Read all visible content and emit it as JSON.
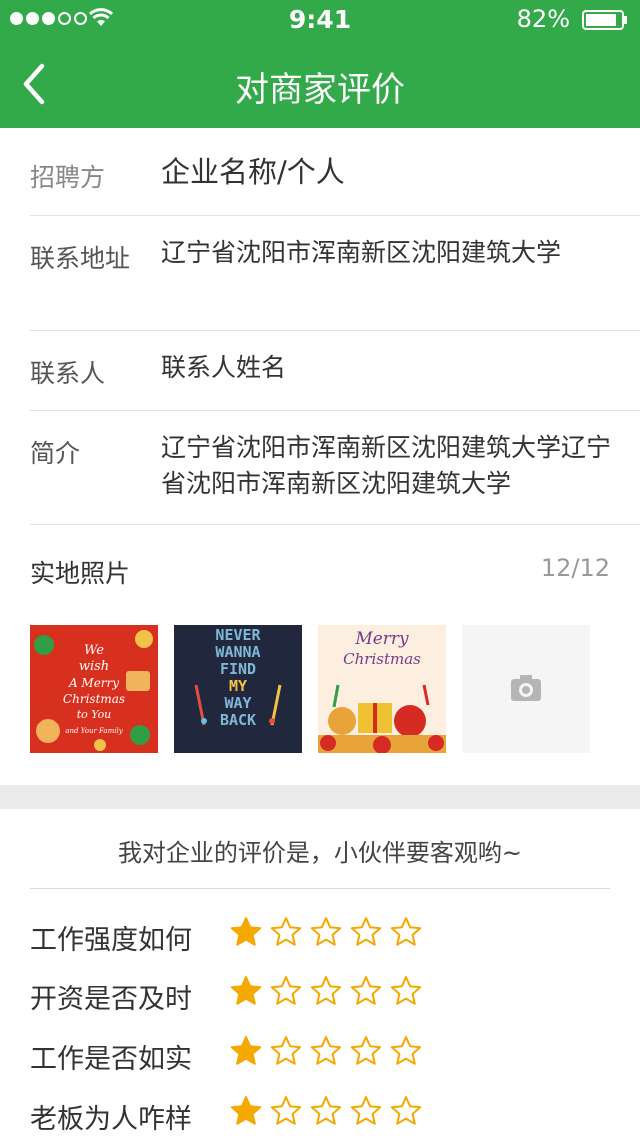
{
  "status": {
    "time": "9:41",
    "battery": "82%"
  },
  "nav": {
    "title": "对商家评价"
  },
  "info": {
    "employer_label": "招聘方",
    "employer_value": "企业名称/个人",
    "address_label": "联系地址",
    "address_value": "辽宁省沈阳市浑南新区沈阳建筑大学",
    "contact_label": "联系人",
    "contact_value": "联系人姓名",
    "intro_label": "简介",
    "intro_value": "辽宁省沈阳市浑南新区沈阳建筑大学辽宁省沈阳市浑南新区沈阳建筑大学"
  },
  "photos": {
    "title": "实地照片",
    "count": "12/12",
    "thumb1": {
      "lines": [
        "We",
        "wish",
        "A Merry",
        "Christmas",
        "to You",
        "and Your Family"
      ]
    },
    "thumb2": {
      "lines": [
        "NEVER",
        "WANNA",
        "FIND",
        "MY",
        "WAY",
        "BACK"
      ]
    },
    "thumb3": {
      "lines": [
        "Merry",
        "Christmas"
      ]
    }
  },
  "rating": {
    "heading": "我对企业的评价是，小伙伴要客观哟~",
    "items": [
      {
        "label": "工作强度如何",
        "stars": 1,
        "max": 5
      },
      {
        "label": "开资是否及时",
        "stars": 1,
        "max": 5
      },
      {
        "label": "工作是否如实",
        "stars": 1,
        "max": 5
      },
      {
        "label": "老板为人咋样",
        "stars": 1,
        "max": 5
      }
    ]
  },
  "colors": {
    "brand": "#33aa4a",
    "star": "#f5a800"
  }
}
